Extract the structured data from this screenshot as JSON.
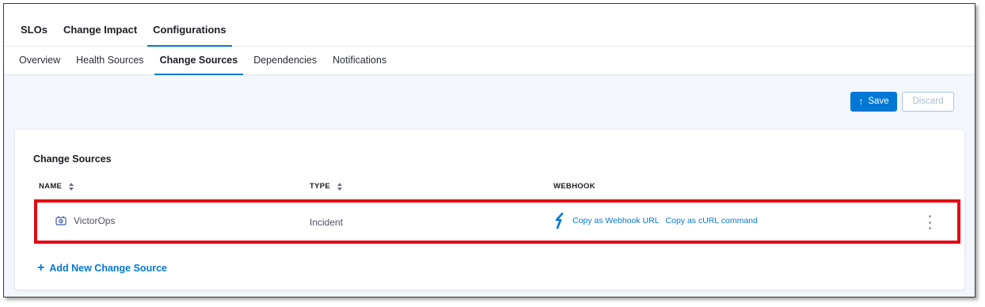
{
  "top_tabs": [
    {
      "label": "SLOs"
    },
    {
      "label": "Change Impact"
    },
    {
      "label": "Configurations"
    }
  ],
  "sub_tabs": [
    {
      "label": "Overview"
    },
    {
      "label": "Health Sources"
    },
    {
      "label": "Change Sources"
    },
    {
      "label": "Dependencies"
    },
    {
      "label": "Notifications"
    }
  ],
  "toolbar": {
    "save_label": "Save",
    "discard_label": "Discard"
  },
  "change_sources": {
    "title": "Change Sources",
    "columns": {
      "name": "NAME",
      "type": "TYPE",
      "webhook": "WEBHOOK"
    },
    "rows": [
      {
        "name": "VictorOps",
        "type": "Incident",
        "copy_webhook_label": "Copy as Webhook URL",
        "copy_curl_label": "Copy as cURL command",
        "icon": "victorops-icon"
      }
    ],
    "add_label": "Add New Change Source"
  },
  "colors": {
    "accent": "#0278d5",
    "highlight": "#e30613",
    "background": "#f3f6fb"
  }
}
